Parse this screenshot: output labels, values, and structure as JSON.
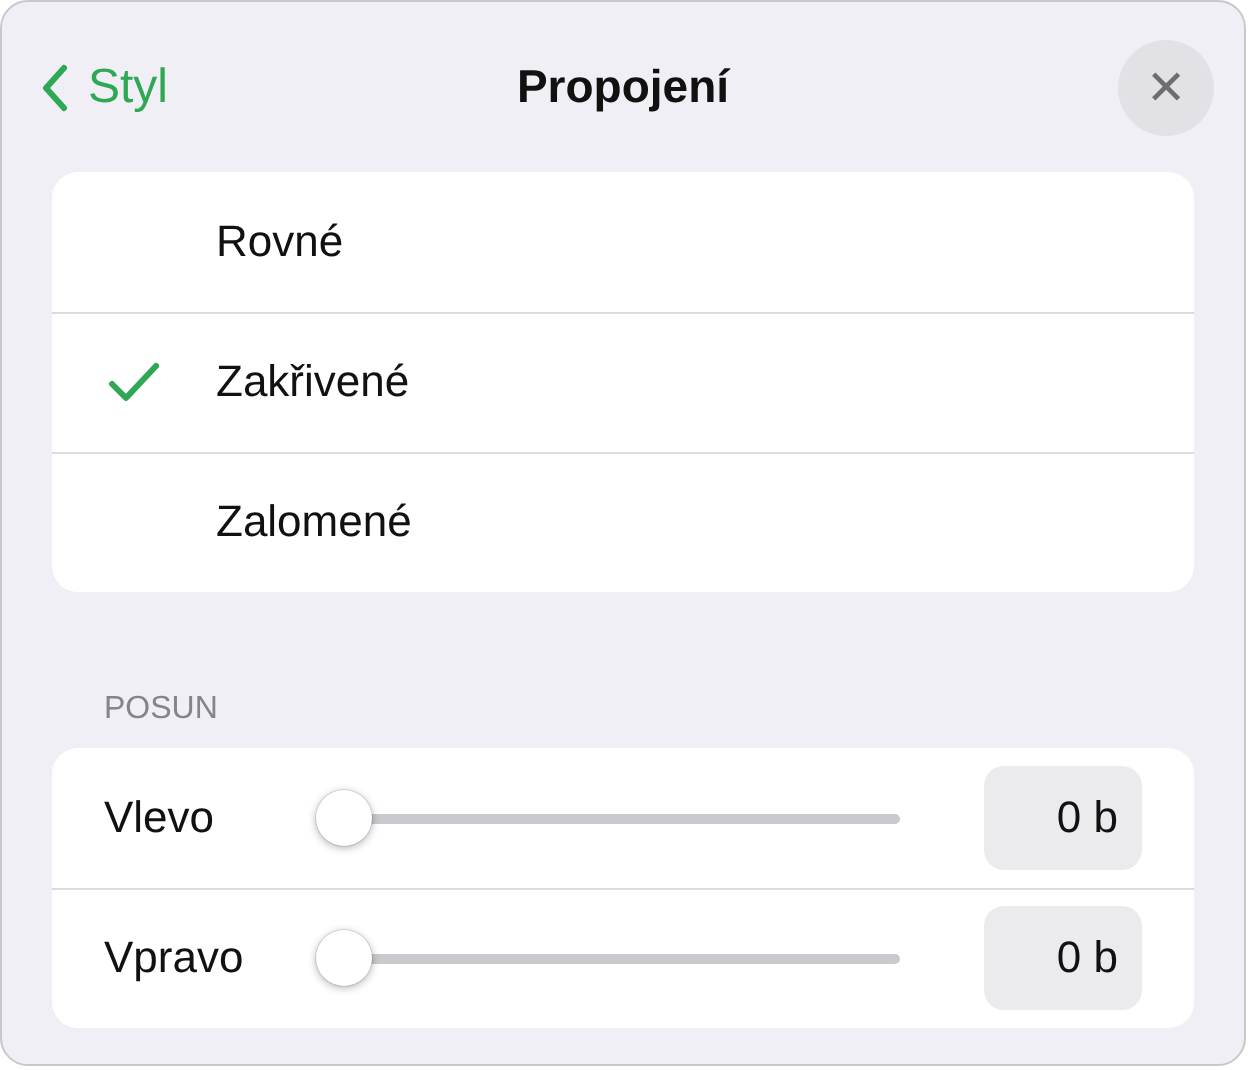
{
  "header": {
    "back": "Styl",
    "title": "Propojení",
    "close": "✕"
  },
  "styles": [
    {
      "label": "Rovné",
      "selected": false
    },
    {
      "label": "Zakřivené",
      "selected": true
    },
    {
      "label": "Zalomené",
      "selected": false
    }
  ],
  "offset": {
    "heading": "POSUN",
    "rows": [
      {
        "label": "Vlevo",
        "level": 0,
        "value": "0 b"
      },
      {
        "label": "Vpravo",
        "level": 0,
        "value": "0 b"
      }
    ]
  }
}
